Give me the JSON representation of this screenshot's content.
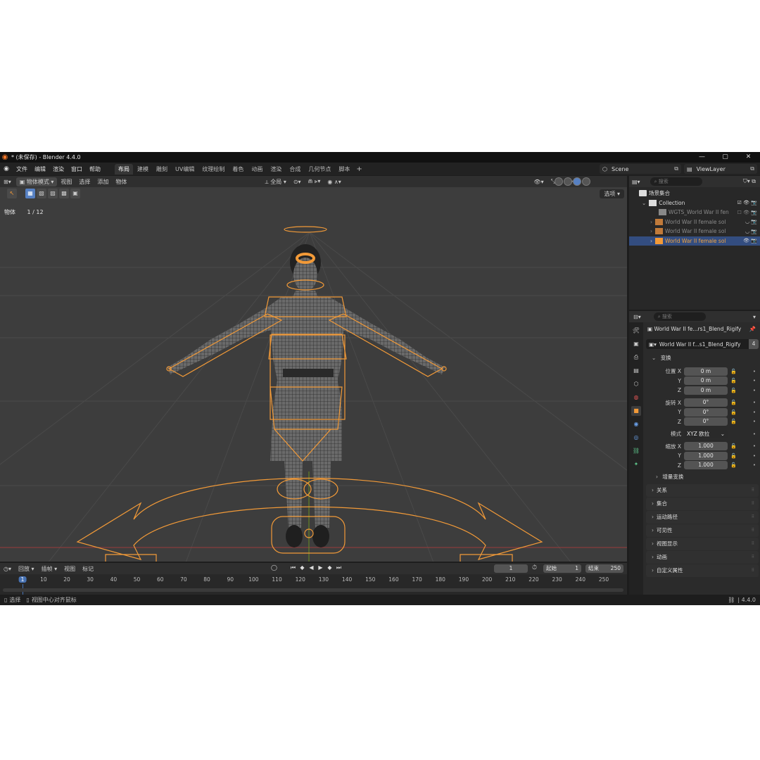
{
  "window": {
    "title": "* (未保存) - Blender 4.4.0",
    "controls": [
      "—",
      "▢",
      "✕"
    ]
  },
  "menu": [
    "文件",
    "编辑",
    "渲染",
    "窗口",
    "帮助"
  ],
  "workspaces": [
    "布局",
    "建模",
    "雕刻",
    "UV编辑",
    "纹理绘制",
    "着色",
    "动画",
    "渲染",
    "合成",
    "几何节点",
    "脚本"
  ],
  "active_workspace": "布局",
  "scene": {
    "name": "Scene",
    "view_layer": "ViewLayer"
  },
  "viewport": {
    "mode": "物体模式",
    "menus": [
      "视图",
      "选择",
      "添加",
      "物体"
    ],
    "transform_orientation": "全局",
    "options_label": "选项",
    "info_label": "物体",
    "info_count": "1 / 12"
  },
  "outliner": {
    "search_placeholder": "搜索",
    "rows": [
      {
        "label": "场景集合",
        "indent": 0,
        "icon": "scene-collection-icon"
      },
      {
        "label": "Collection",
        "indent": 1,
        "icon": "collection-icon"
      },
      {
        "label": "WGTS_World War II fen",
        "indent": 2,
        "icon": "collection-icon",
        "dim": true
      },
      {
        "label": "World War II female sol",
        "indent": 2,
        "icon": "armature-icon",
        "dim": true
      },
      {
        "label": "World War II female sol",
        "indent": 2,
        "icon": "armature-icon",
        "dim": true
      },
      {
        "label": "World War II female sol",
        "indent": 2,
        "icon": "armature-icon",
        "selected": true
      }
    ]
  },
  "properties": {
    "search_placeholder": "搜索",
    "object_name": "World War II fe...rs1_Blend_Rigify",
    "data_name": "World War II f...s1_Blend_Rigify",
    "data_users": "4",
    "transform_title": "变换",
    "location_label": "位置 X",
    "location": [
      "0 m",
      "0 m",
      "0 m"
    ],
    "rotation_label": "旋转 X",
    "rotation": [
      "0°",
      "0°",
      "0°"
    ],
    "mode_label": "模式",
    "rotation_mode": "XYZ 欧拉",
    "scale_label": "缩放 X",
    "scale": [
      "1.000",
      "1.000",
      "1.000"
    ],
    "axis_y": "Y",
    "axis_z": "Z",
    "delta_transform": "增量变换",
    "panels": [
      "关系",
      "集合",
      "运动路径",
      "可见性",
      "视图显示",
      "动画",
      "自定义属性"
    ]
  },
  "timeline": {
    "menus": [
      "回放",
      "插帧",
      "视图",
      "标记"
    ],
    "current_frame": "1",
    "start_label": "起始",
    "start": "1",
    "end_label": "结束",
    "end": "250",
    "ticks": [
      "1",
      "10",
      "20",
      "30",
      "40",
      "50",
      "60",
      "70",
      "80",
      "90",
      "100",
      "110",
      "120",
      "130",
      "140",
      "150",
      "160",
      "170",
      "180",
      "190",
      "200",
      "210",
      "220",
      "230",
      "240",
      "250"
    ]
  },
  "statusbar": {
    "select": "选择",
    "center_view": "视图中心对齐鼠标",
    "version": "4.4.0"
  },
  "colors": {
    "accent_orange": "#f29a38",
    "selection_blue": "#4772b3",
    "viewport_bg": "#3d3d3d"
  }
}
